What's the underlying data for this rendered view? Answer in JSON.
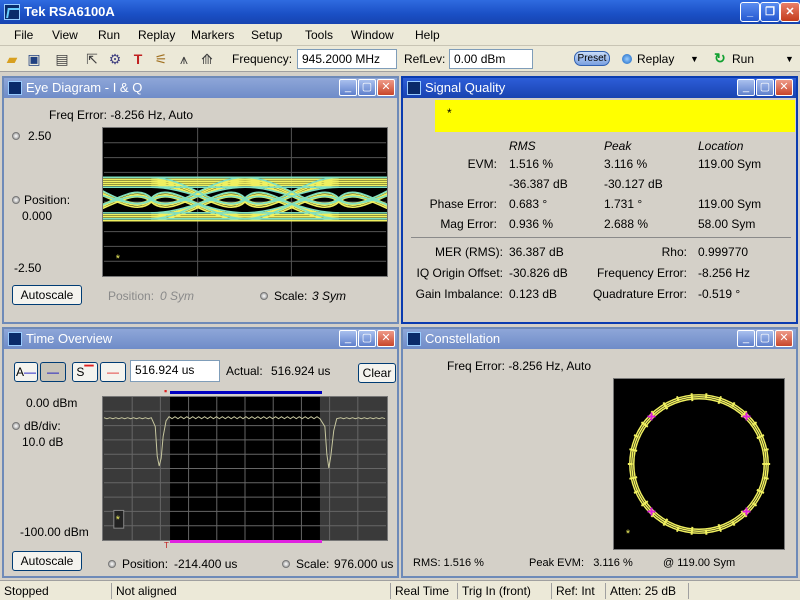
{
  "window": {
    "title": "Tek RSA6100A"
  },
  "menu": [
    "File",
    "View",
    "Run",
    "Replay",
    "Markers",
    "Setup",
    "Tools",
    "Window",
    "Help"
  ],
  "toolbar": {
    "frequency_label": "Frequency:",
    "frequency_value": "945.2000 MHz",
    "reflev_label": "RefLev:",
    "reflev_value": "0.00 dBm",
    "preset_label": "Preset",
    "replay_label": "Replay",
    "run_label": "Run"
  },
  "eye": {
    "title": "Eye Diagram - I & Q",
    "freq_error": "Freq Error: -8.256 Hz, Auto",
    "top_value": "2.50",
    "position_label": "Position:",
    "position_value": "0.000",
    "bottom_value": "-2.50",
    "autoscale": "Autoscale",
    "position_sym": "Position:",
    "position_sym_value": "0 Sym",
    "scale_label": "Scale:",
    "scale_value": "3 Sym",
    "marker": "*"
  },
  "sq": {
    "title": "Signal Quality",
    "banner": "*",
    "headers": {
      "rms": "RMS",
      "peak": "Peak",
      "location": "Location"
    },
    "rows": [
      {
        "label": "EVM:",
        "rms": "1.516 %",
        "peak": "3.116 %",
        "loc": "119.00 Sym"
      },
      {
        "label": "",
        "rms": "-36.387 dB",
        "peak": "-30.127 dB",
        "loc": ""
      },
      {
        "label": "Phase Error:",
        "rms": "0.683 °",
        "peak": "1.731 °",
        "loc": "119.00 Sym"
      },
      {
        "label": "Mag Error:",
        "rms": "0.936 %",
        "peak": "2.688 %",
        "loc": "58.00 Sym"
      }
    ],
    "bottom": [
      {
        "label": "MER (RMS):",
        "value": "36.387 dB",
        "label2": "Rho:",
        "value2": "0.999770"
      },
      {
        "label": "IQ Origin Offset:",
        "value": "-30.826 dB",
        "label2": "Frequency Error:",
        "value2": "-8.256 Hz"
      },
      {
        "label": "Gain Imbalance:",
        "value": "0.123 dB",
        "label2": "Quadrature Error:",
        "value2": "-0.519 °"
      }
    ]
  },
  "time": {
    "title": "Time Overview",
    "btn_a": "A",
    "btn_s": "S",
    "time_value": "516.924 us",
    "actual_label": "Actual:",
    "actual_value": "516.924 us",
    "clear": "Clear",
    "ref_value": "0.00 dBm",
    "dbdiv_label": "dB/div:",
    "dbdiv_value": "10.0 dB",
    "bottom_value": "-100.00 dBm",
    "autoscale": "Autoscale",
    "position_label": "Position:",
    "position_value": "-214.400 us",
    "scale_label": "Scale:",
    "scale_value": "976.000 us",
    "marker": "*",
    "trigger_t": "T"
  },
  "const": {
    "title": "Constellation",
    "freq_error": "Freq Error: -8.256 Hz, Auto",
    "rms": "RMS:  1.516 %",
    "peak_evm": "Peak EVM:   3.116 %",
    "at_sym": "@  119.00 Sym",
    "marker": "*"
  },
  "status": [
    "Stopped",
    "Not aligned",
    "Real Time",
    "Trig In (front)",
    "Ref: Int",
    "Atten: 25 dB"
  ],
  "colors": {
    "trace_yellow": "#f0f060",
    "trace_cyan": "#80e0c0",
    "magenta": "#e020e0",
    "blue": "#0000c0"
  }
}
